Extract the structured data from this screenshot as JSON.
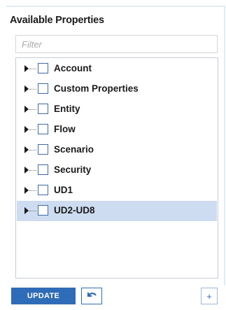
{
  "panel": {
    "title": "Available Properties"
  },
  "filter": {
    "placeholder": "Filter",
    "value": ""
  },
  "tree": {
    "items": [
      {
        "label": "Account",
        "selected": false,
        "checked": false
      },
      {
        "label": "Custom Properties",
        "selected": false,
        "checked": false
      },
      {
        "label": "Entity",
        "selected": false,
        "checked": false
      },
      {
        "label": "Flow",
        "selected": false,
        "checked": false
      },
      {
        "label": "Scenario",
        "selected": false,
        "checked": false
      },
      {
        "label": "Security",
        "selected": false,
        "checked": false
      },
      {
        "label": "UD1",
        "selected": false,
        "checked": false
      },
      {
        "label": "UD2-UD8",
        "selected": true,
        "checked": false
      }
    ]
  },
  "footer": {
    "update_label": "UPDATE",
    "undo_icon": "undo-icon",
    "add_label": "+"
  },
  "colors": {
    "accent": "#2f6cb7",
    "selected_row": "#cddcf0",
    "checkbox_border": "#3e6aa8"
  }
}
